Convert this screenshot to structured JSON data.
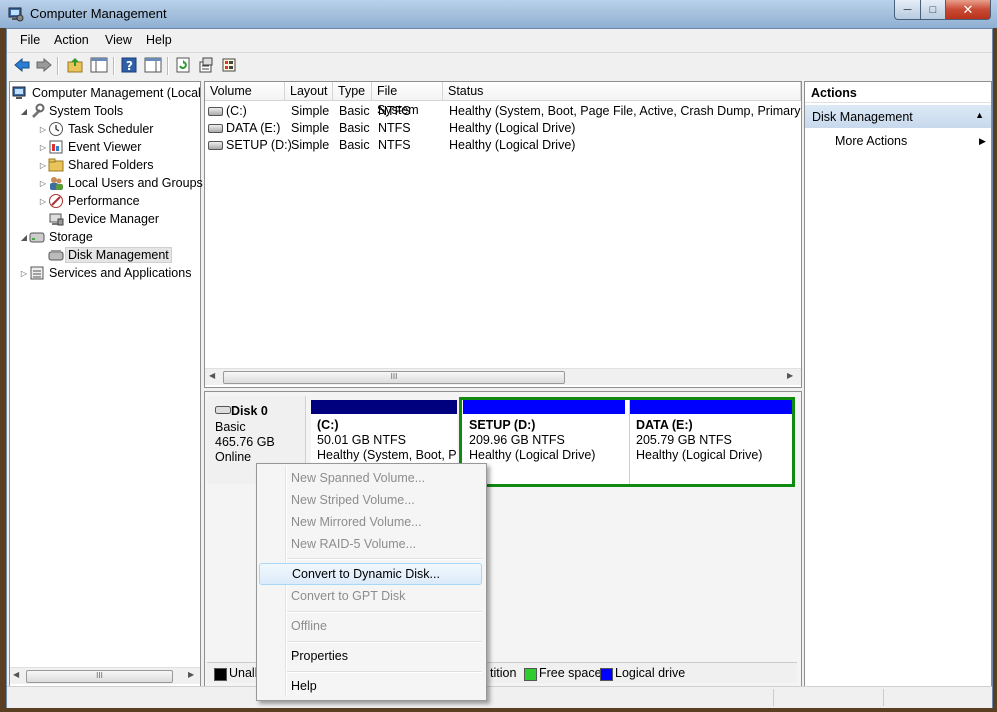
{
  "window": {
    "title": "Computer Management",
    "min_glyph": "─",
    "max_glyph": "□",
    "close_glyph": "✕"
  },
  "menu": [
    "File",
    "Action",
    "View",
    "Help"
  ],
  "tree": {
    "root": "Computer Management (Local",
    "system_tools": "System Tools",
    "task_scheduler": "Task Scheduler",
    "event_viewer": "Event Viewer",
    "shared_folders": "Shared Folders",
    "local_users": "Local Users and Groups",
    "performance": "Performance",
    "device_manager": "Device Manager",
    "storage": "Storage",
    "disk_management": "Disk Management",
    "services": "Services and Applications"
  },
  "volume_list": {
    "columns": [
      "Volume",
      "Layout",
      "Type",
      "File System",
      "Status"
    ],
    "rows": [
      {
        "volume": "(C:)",
        "layout": "Simple",
        "type": "Basic",
        "fs": "NTFS",
        "status": "Healthy (System, Boot, Page File, Active, Crash Dump, Primary Part"
      },
      {
        "volume": "DATA (E:)",
        "layout": "Simple",
        "type": "Basic",
        "fs": "NTFS",
        "status": "Healthy (Logical Drive)"
      },
      {
        "volume": "SETUP (D:)",
        "layout": "Simple",
        "type": "Basic",
        "fs": "NTFS",
        "status": "Healthy (Logical Drive)"
      }
    ]
  },
  "disk": {
    "name": "Disk 0",
    "type": "Basic",
    "size": "465.76 GB",
    "state": "Online"
  },
  "partitions": [
    {
      "name": "(C:)",
      "size": "50.01 GB NTFS",
      "status": "Healthy (System, Boot, Pa"
    },
    {
      "name": "SETUP  (D:)",
      "size": "209.96 GB NTFS",
      "status": "Healthy (Logical Drive)"
    },
    {
      "name": "DATA  (E:)",
      "size": "205.79 GB NTFS",
      "status": "Healthy (Logical Drive)"
    }
  ],
  "legend": {
    "unalloc": "Unallo",
    "partition": "tition",
    "free": "Free space",
    "logical": "Logical drive"
  },
  "actions": {
    "header": "Actions",
    "section": "Disk Management",
    "more": "More Actions"
  },
  "context_menu": {
    "new_spanned": "New Spanned Volume...",
    "new_striped": "New Striped Volume...",
    "new_mirrored": "New Mirrored Volume...",
    "new_raid5": "New RAID-5 Volume...",
    "convert_dynamic": "Convert to Dynamic Disk...",
    "convert_gpt": "Convert to GPT Disk",
    "offline": "Offline",
    "properties": "Properties",
    "help": "Help"
  },
  "colors": {
    "primary_partition": "#00007f",
    "logical_drive": "#0000ff",
    "free_space": "#2dcd2d",
    "extended_border": "#118a11",
    "unallocated": "#000000"
  }
}
